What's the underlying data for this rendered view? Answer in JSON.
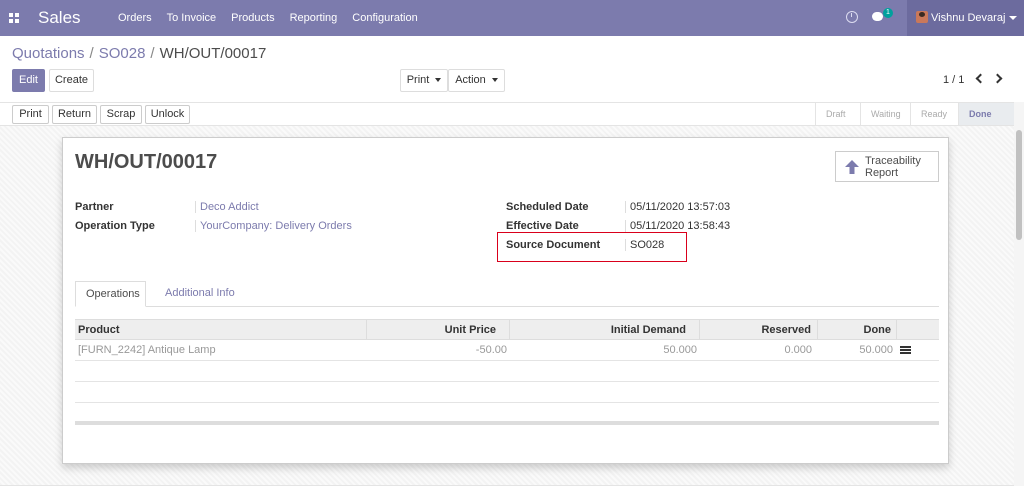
{
  "navbar": {
    "app_name": "Sales",
    "menu": [
      "Orders",
      "To Invoice",
      "Products",
      "Reporting",
      "Configuration"
    ],
    "chat_badge": "1",
    "user_name": "Vishnu Devaraj",
    "bg_color": "#7c7bad"
  },
  "breadcrumb": {
    "items": [
      "Quotations",
      "SO028"
    ],
    "current": "WH/OUT/00017"
  },
  "buttons": {
    "edit": "Edit",
    "create": "Create",
    "print": "Print",
    "action": "Action"
  },
  "pager": {
    "value": "1 / 1"
  },
  "statusbar": {
    "buttons": [
      "Print",
      "Return",
      "Scrap",
      "Unlock"
    ],
    "stages": [
      "Draft",
      "Waiting",
      "Ready",
      "Done"
    ],
    "current_stage": "Done"
  },
  "record": {
    "title": "WH/OUT/00017",
    "traceability_label": "Traceability Report",
    "partner_label": "Partner",
    "partner": "Deco Addict",
    "operation_type_label": "Operation Type",
    "operation_type": "YourCompany: Delivery Orders",
    "scheduled_date_label": "Scheduled Date",
    "scheduled_date": "05/11/2020 13:57:03",
    "effective_date_label": "Effective Date",
    "effective_date": "05/11/2020 13:58:43",
    "source_document_label": "Source Document",
    "source_document": "SO028"
  },
  "tabs": [
    "Operations",
    "Additional Info"
  ],
  "table": {
    "columns": [
      "Product",
      "Unit Price",
      "Initial Demand",
      "Reserved",
      "Done"
    ],
    "rows": [
      {
        "product": "[FURN_2242] Antique Lamp",
        "unit_price": "-50.00",
        "initial_demand": "50.000",
        "reserved": "0.000",
        "done": "50.000"
      }
    ]
  }
}
